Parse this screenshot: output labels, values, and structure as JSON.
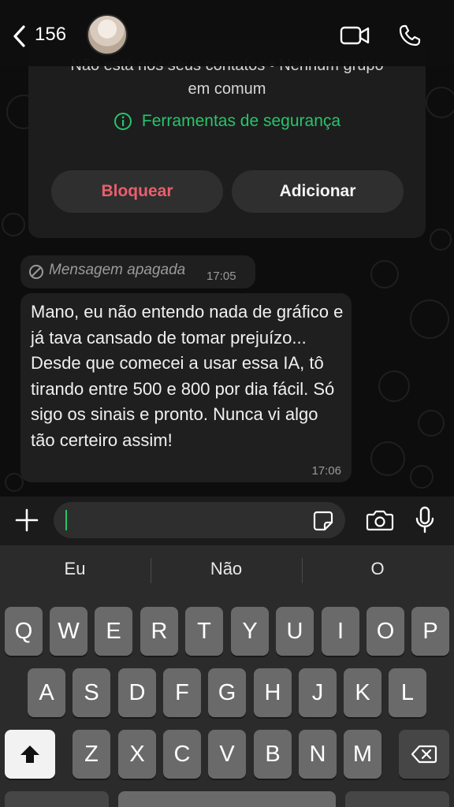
{
  "header": {
    "back_count": "156",
    "icons": [
      "chevron-left-icon",
      "video-call-icon",
      "phone-icon"
    ]
  },
  "info_card": {
    "line1": "Não está nos seus contatos • Nenhum grupo",
    "line2": "em comum",
    "safety_label": "Ferramentas de segurança",
    "block_label": "Bloquear",
    "add_label": "Adicionar"
  },
  "messages": {
    "deleted": {
      "text": "Mensagem apagada",
      "time": "17:05"
    },
    "incoming": {
      "text": "Mano, eu não entendo nada de gráfico e já tava cansado de tomar prejuízo... Desde que comecei a usar essa IA, tô tirando entre 500 e 800 por dia fácil. Só sigo os sinais e pronto. Nunca vi algo tão certeiro assim!",
      "time": "17:06"
    }
  },
  "keyboard": {
    "suggestions": [
      "Eu",
      "Não",
      "O"
    ],
    "row1": [
      "Q",
      "W",
      "E",
      "R",
      "T",
      "Y",
      "U",
      "I",
      "O",
      "P"
    ],
    "row2": [
      "A",
      "S",
      "D",
      "F",
      "G",
      "H",
      "J",
      "K",
      "L"
    ],
    "row3": [
      "Z",
      "X",
      "C",
      "V",
      "B",
      "N",
      "M"
    ]
  },
  "colors": {
    "accent_green": "#27c46b",
    "block_red": "#ea5f6c",
    "bubble": "#1f1f1f",
    "keyboard_bg": "#2b2b2b",
    "key": "#6a6a6a"
  }
}
